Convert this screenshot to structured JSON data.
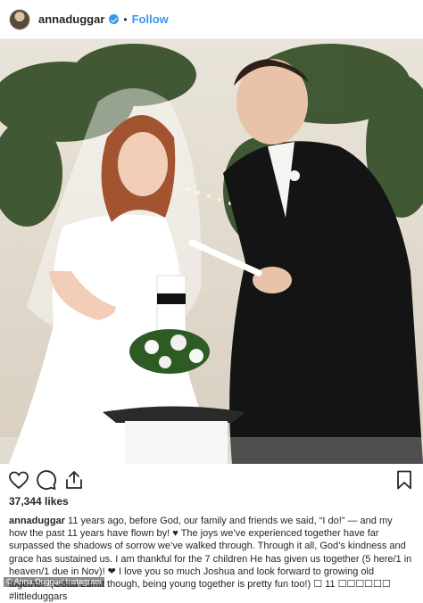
{
  "header": {
    "username": "annaduggar",
    "separator": "•",
    "follow_label": "Follow"
  },
  "icons": {
    "like": "heart-icon",
    "comment": "comment-icon",
    "share": "share-icon",
    "save": "bookmark-icon",
    "verified": "verified-badge-icon"
  },
  "colors": {
    "accent": "#3897f0",
    "text": "#262626"
  },
  "post": {
    "likes": "37,344 likes",
    "caption_user": "annaduggar",
    "caption_text": "11 years ago, before God, our family and friends we said, “I do!” — and my how the past 11 years have flown by! ♥ The joys we’ve experienced together have far surpassed the shadows of sorrow we’ve walked through. Through it all, God’s kindness and grace has sustained us. I am thankful for the 7 children He has given us together (5 here/1 in heaven/1 due in Nov)! ❤ I love you so much Joshua and look forward to growing old together! (Gotta admit though, being young together is pretty fun too!) ☐ 11 ☐☐☐☐☐☐ #littleduggars"
  },
  "credit": "© Anna Duggar/ Instagram"
}
